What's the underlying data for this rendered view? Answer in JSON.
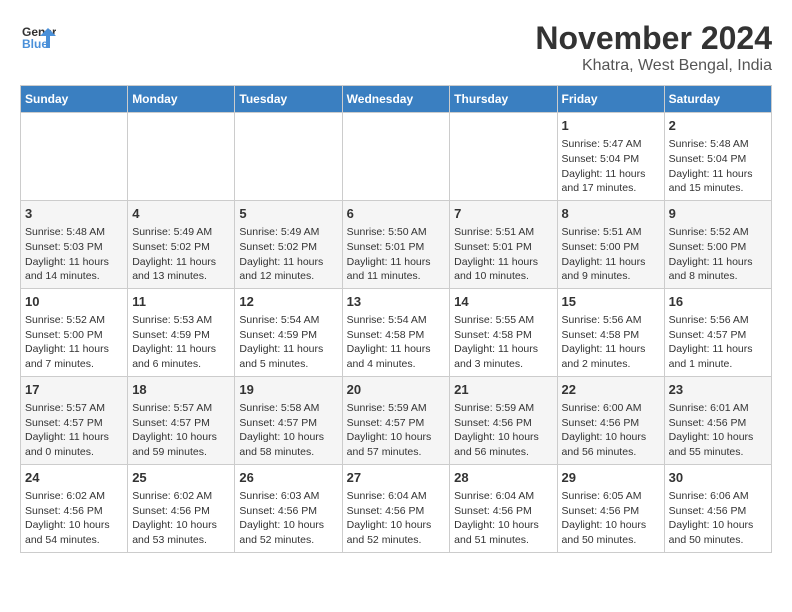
{
  "logo": {
    "line1": "General",
    "line2": "Blue"
  },
  "title": "November 2024",
  "subtitle": "Khatra, West Bengal, India",
  "weekdays": [
    "Sunday",
    "Monday",
    "Tuesday",
    "Wednesday",
    "Thursday",
    "Friday",
    "Saturday"
  ],
  "weeks": [
    [
      {
        "day": "",
        "info": ""
      },
      {
        "day": "",
        "info": ""
      },
      {
        "day": "",
        "info": ""
      },
      {
        "day": "",
        "info": ""
      },
      {
        "day": "",
        "info": ""
      },
      {
        "day": "1",
        "info": "Sunrise: 5:47 AM\nSunset: 5:04 PM\nDaylight: 11 hours and 17 minutes."
      },
      {
        "day": "2",
        "info": "Sunrise: 5:48 AM\nSunset: 5:04 PM\nDaylight: 11 hours and 15 minutes."
      }
    ],
    [
      {
        "day": "3",
        "info": "Sunrise: 5:48 AM\nSunset: 5:03 PM\nDaylight: 11 hours and 14 minutes."
      },
      {
        "day": "4",
        "info": "Sunrise: 5:49 AM\nSunset: 5:02 PM\nDaylight: 11 hours and 13 minutes."
      },
      {
        "day": "5",
        "info": "Sunrise: 5:49 AM\nSunset: 5:02 PM\nDaylight: 11 hours and 12 minutes."
      },
      {
        "day": "6",
        "info": "Sunrise: 5:50 AM\nSunset: 5:01 PM\nDaylight: 11 hours and 11 minutes."
      },
      {
        "day": "7",
        "info": "Sunrise: 5:51 AM\nSunset: 5:01 PM\nDaylight: 11 hours and 10 minutes."
      },
      {
        "day": "8",
        "info": "Sunrise: 5:51 AM\nSunset: 5:00 PM\nDaylight: 11 hours and 9 minutes."
      },
      {
        "day": "9",
        "info": "Sunrise: 5:52 AM\nSunset: 5:00 PM\nDaylight: 11 hours and 8 minutes."
      }
    ],
    [
      {
        "day": "10",
        "info": "Sunrise: 5:52 AM\nSunset: 5:00 PM\nDaylight: 11 hours and 7 minutes."
      },
      {
        "day": "11",
        "info": "Sunrise: 5:53 AM\nSunset: 4:59 PM\nDaylight: 11 hours and 6 minutes."
      },
      {
        "day": "12",
        "info": "Sunrise: 5:54 AM\nSunset: 4:59 PM\nDaylight: 11 hours and 5 minutes."
      },
      {
        "day": "13",
        "info": "Sunrise: 5:54 AM\nSunset: 4:58 PM\nDaylight: 11 hours and 4 minutes."
      },
      {
        "day": "14",
        "info": "Sunrise: 5:55 AM\nSunset: 4:58 PM\nDaylight: 11 hours and 3 minutes."
      },
      {
        "day": "15",
        "info": "Sunrise: 5:56 AM\nSunset: 4:58 PM\nDaylight: 11 hours and 2 minutes."
      },
      {
        "day": "16",
        "info": "Sunrise: 5:56 AM\nSunset: 4:57 PM\nDaylight: 11 hours and 1 minute."
      }
    ],
    [
      {
        "day": "17",
        "info": "Sunrise: 5:57 AM\nSunset: 4:57 PM\nDaylight: 11 hours and 0 minutes."
      },
      {
        "day": "18",
        "info": "Sunrise: 5:57 AM\nSunset: 4:57 PM\nDaylight: 10 hours and 59 minutes."
      },
      {
        "day": "19",
        "info": "Sunrise: 5:58 AM\nSunset: 4:57 PM\nDaylight: 10 hours and 58 minutes."
      },
      {
        "day": "20",
        "info": "Sunrise: 5:59 AM\nSunset: 4:57 PM\nDaylight: 10 hours and 57 minutes."
      },
      {
        "day": "21",
        "info": "Sunrise: 5:59 AM\nSunset: 4:56 PM\nDaylight: 10 hours and 56 minutes."
      },
      {
        "day": "22",
        "info": "Sunrise: 6:00 AM\nSunset: 4:56 PM\nDaylight: 10 hours and 56 minutes."
      },
      {
        "day": "23",
        "info": "Sunrise: 6:01 AM\nSunset: 4:56 PM\nDaylight: 10 hours and 55 minutes."
      }
    ],
    [
      {
        "day": "24",
        "info": "Sunrise: 6:02 AM\nSunset: 4:56 PM\nDaylight: 10 hours and 54 minutes."
      },
      {
        "day": "25",
        "info": "Sunrise: 6:02 AM\nSunset: 4:56 PM\nDaylight: 10 hours and 53 minutes."
      },
      {
        "day": "26",
        "info": "Sunrise: 6:03 AM\nSunset: 4:56 PM\nDaylight: 10 hours and 52 minutes."
      },
      {
        "day": "27",
        "info": "Sunrise: 6:04 AM\nSunset: 4:56 PM\nDaylight: 10 hours and 52 minutes."
      },
      {
        "day": "28",
        "info": "Sunrise: 6:04 AM\nSunset: 4:56 PM\nDaylight: 10 hours and 51 minutes."
      },
      {
        "day": "29",
        "info": "Sunrise: 6:05 AM\nSunset: 4:56 PM\nDaylight: 10 hours and 50 minutes."
      },
      {
        "day": "30",
        "info": "Sunrise: 6:06 AM\nSunset: 4:56 PM\nDaylight: 10 hours and 50 minutes."
      }
    ]
  ]
}
